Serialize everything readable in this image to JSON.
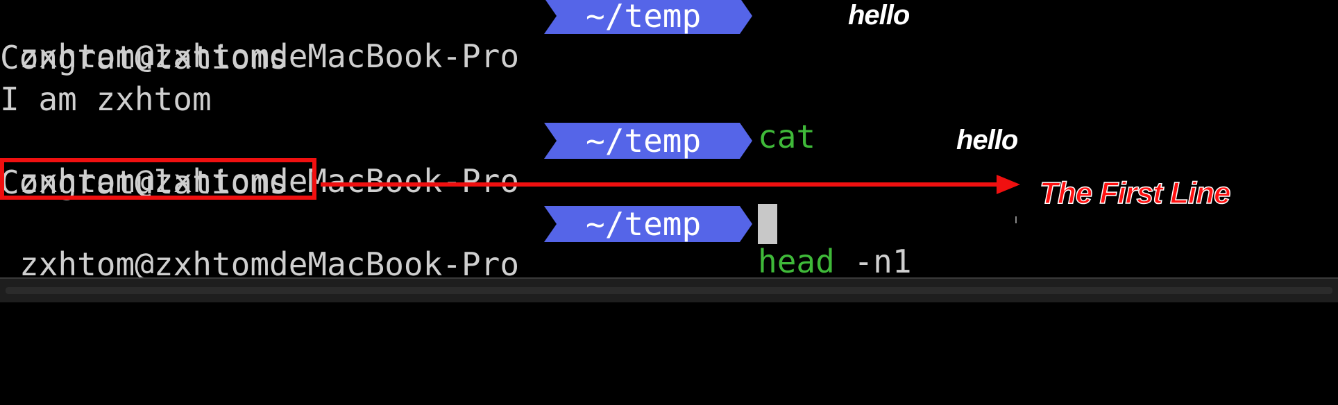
{
  "terminal": {
    "prompt_user": "zxhtom@zxhtomdeMacBook-Pro",
    "prompt_path": "~/temp",
    "commands": [
      {
        "cmd": "cat",
        "arg": ""
      },
      {
        "cmd": "head",
        "arg": " -n1"
      }
    ],
    "output": {
      "cat_lines": [
        "Congratulations",
        "I am zxhtom"
      ],
      "head_lines": [
        "Congratulations"
      ]
    }
  },
  "annotations": {
    "hello_1": "hello",
    "hello_2": "hello",
    "first_line": "The First Line",
    "arrow_color": "#f01010"
  },
  "colors": {
    "prompt_path_bg": "#5565e8",
    "command": "#3fb939",
    "text": "#cfcfcf"
  }
}
